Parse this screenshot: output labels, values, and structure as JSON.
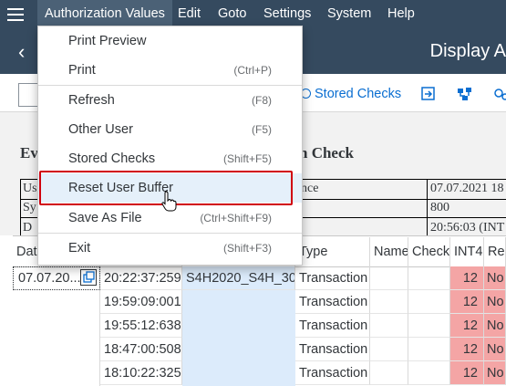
{
  "menubar": {
    "items": [
      "Authorization Values",
      "Edit",
      "Goto",
      "Settings",
      "System",
      "Help"
    ]
  },
  "titlebar": {
    "title": "Display A"
  },
  "toolbar": {
    "stored_checks": "Stored Checks"
  },
  "form": {
    "heading_left": "Ev",
    "heading_right": "n Check",
    "rows": [
      {
        "left": "Us",
        "mid": "nce",
        "right": "07.07.2021 18"
      },
      {
        "left": "Sy",
        "mid": "",
        "right": "800"
      },
      {
        "left": "D",
        "mid": "",
        "right": "20:56:03 (INT"
      }
    ]
  },
  "grid": {
    "headers": [
      "Dat",
      "",
      "",
      "Type",
      "Name",
      "Check",
      "INT4",
      "Res"
    ],
    "first_date": "07.07.20...",
    "rows": [
      {
        "time": "20:22:37:259",
        "user": "S4H2020_S4H_30",
        "type": "Transaction",
        "int4": "12",
        "res": "No"
      },
      {
        "time": "19:59:09:001",
        "user": "",
        "type": "Transaction",
        "int4": "12",
        "res": "No"
      },
      {
        "time": "19:55:12:638",
        "user": "",
        "type": "Transaction",
        "int4": "12",
        "res": "No"
      },
      {
        "time": "18:47:00:508",
        "user": "",
        "type": "Transaction",
        "int4": "12",
        "res": "No"
      },
      {
        "time": "18:10:22:325",
        "user": "",
        "type": "Transaction",
        "int4": "12",
        "res": "No"
      }
    ]
  },
  "menu": {
    "items": [
      {
        "label": "Print Preview",
        "shortcut": ""
      },
      {
        "label": "Print",
        "shortcut": "(Ctrl+P)"
      },
      {
        "label": "Refresh",
        "shortcut": "(F8)"
      },
      {
        "label": "Other User",
        "shortcut": "(F5)"
      },
      {
        "label": "Stored Checks",
        "shortcut": "(Shift+F5)"
      },
      {
        "label": "Reset User Buffer",
        "shortcut": ""
      },
      {
        "label": "Save As File",
        "shortcut": "(Ctrl+Shift+F9)"
      },
      {
        "label": "Exit",
        "shortcut": "(Shift+F3)"
      }
    ]
  },
  "colors": {
    "shell": "#354a5f",
    "link": "#0a6ed1",
    "error_cell": "#f4a5a5",
    "highlight_border": "#d0000d",
    "user_column": "#dcebfb"
  }
}
